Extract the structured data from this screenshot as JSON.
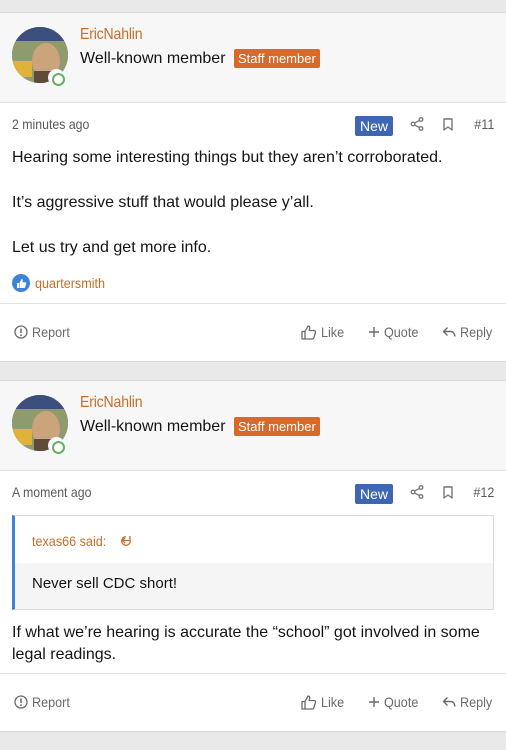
{
  "posts": [
    {
      "username": "EricNahlin",
      "user_title": "Well-known member",
      "staff_label": "Staff member",
      "time": "2 minutes ago",
      "new_label": "New",
      "post_number": "#11",
      "paragraphs": [
        "Hearing some interesting things but they aren’t corroborated.",
        "It’s aggressive stuff that would please y’all.",
        "Let us try and get more info."
      ],
      "reaction_user": "quartersmith",
      "actions": {
        "report": "Report",
        "like": "Like",
        "quote": "Quote",
        "reply": "Reply"
      }
    },
    {
      "username": "EricNahlin",
      "user_title": "Well-known member",
      "staff_label": "Staff member",
      "time": "A moment ago",
      "new_label": "New",
      "post_number": "#12",
      "quote": {
        "author": "texas66 said:",
        "text": "Never sell CDC short!"
      },
      "paragraphs": [
        "If what we’re hearing is accurate the “school” got involved in some legal readings."
      ],
      "actions": {
        "report": "Report",
        "like": "Like",
        "quote": "Quote",
        "reply": "Reply"
      }
    }
  ],
  "colors": {
    "username": "#c86e2a",
    "staff_badge": "#d7692a",
    "new_badge": "#3e66b3",
    "online": "#63b265",
    "quote_border": "#3f83d8"
  },
  "icons": [
    "share-icon",
    "bookmark-icon",
    "report-icon",
    "like-icon",
    "quote-icon",
    "reply-icon",
    "reaction-like-icon",
    "quote-jump-icon",
    "online-icon"
  ]
}
